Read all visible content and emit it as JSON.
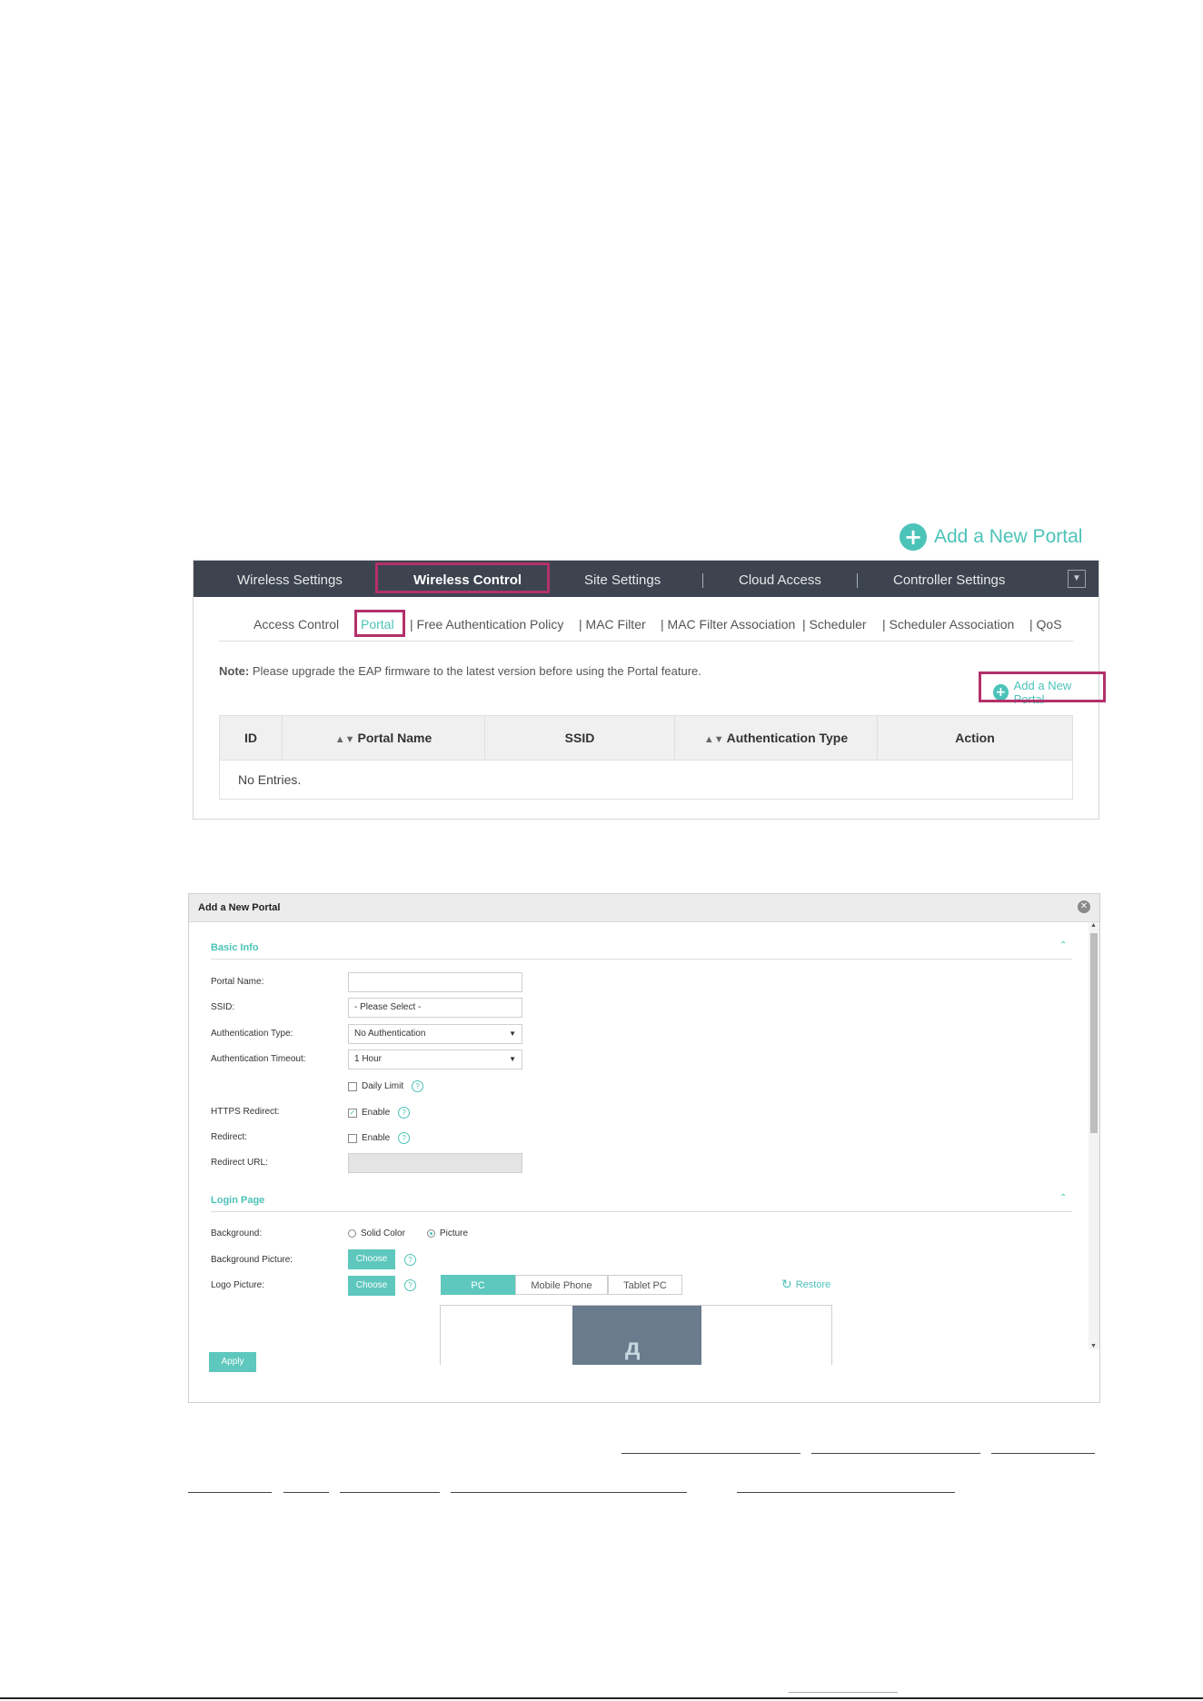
{
  "callout": {
    "label": "Add a New Portal"
  },
  "controller": {
    "topnav": [
      "Wireless Settings",
      "Wireless Control",
      "Site Settings",
      "Cloud Access",
      "Controller Settings"
    ],
    "subtabs": [
      "Access Control",
      "Portal",
      "| Free Authentication Policy",
      "| MAC Filter",
      "| MAC Filter Association",
      "| Scheduler",
      "| Scheduler Association",
      "| QoS"
    ],
    "note_label": "Note:",
    "note_text": " Please upgrade the EAP firmware to the latest version before using the Portal feature.",
    "add_label": "Add a New Portal",
    "columns": [
      "ID",
      "Portal Name",
      "SSID",
      "Authentication Type",
      "Action"
    ],
    "empty_text": "No Entries."
  },
  "modal": {
    "title": "Add a New Portal",
    "basic_info": {
      "section_label": "Basic Info",
      "portal_name_label": "Portal Name:",
      "portal_name_value": "",
      "ssid_label": "SSID:",
      "ssid_value": "- Please Select -",
      "auth_type_label": "Authentication Type:",
      "auth_type_value": "No Authentication",
      "auth_timeout_label": "Authentication Timeout:",
      "auth_timeout_value": "1 Hour",
      "daily_limit_label": "Daily Limit",
      "https_label": "HTTPS Redirect:",
      "https_enable": "Enable",
      "redirect_label": "Redirect:",
      "redirect_enable": "Enable",
      "redirect_url_label": "Redirect URL:"
    },
    "login_page": {
      "section_label": "Login Page",
      "background_label": "Background:",
      "solid_color": "Solid Color",
      "picture": "Picture",
      "bg_picture_label": "Background Picture:",
      "logo_picture_label": "Logo Picture:",
      "choose": "Choose",
      "device_tabs": [
        "PC",
        "Mobile Phone",
        "Tablet PC"
      ],
      "restore": "Restore"
    },
    "apply": "Apply"
  },
  "colors": {
    "accent": "#4cc3b8",
    "highlight": "#b3306a",
    "nav": "#3d4450"
  }
}
